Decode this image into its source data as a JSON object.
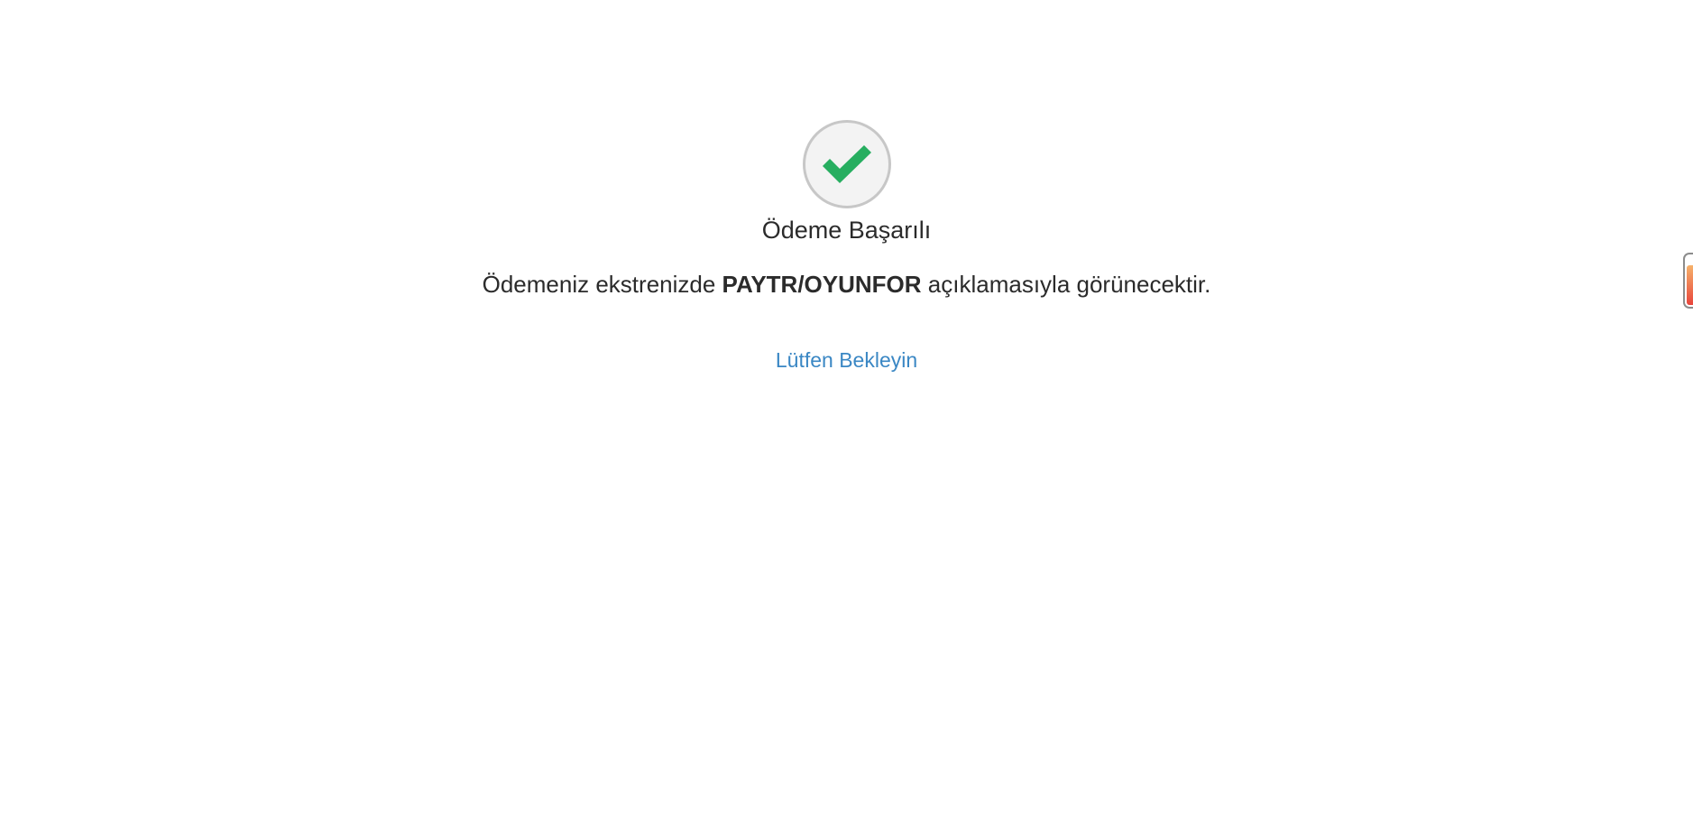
{
  "status": {
    "icon": "checkmark-icon",
    "icon_color": "#27ae60",
    "title": "Ödeme Başarılı"
  },
  "message": {
    "prefix": "Ödemeniz ekstrenizde ",
    "descriptor": "PAYTR/OYUNFOR",
    "suffix": " açıklamasıyla görünecektir."
  },
  "wait_link": {
    "label": "Lütfen Bekleyin",
    "color": "#3a87c4"
  },
  "edge_widget": {
    "icon": "side-tab-icon",
    "fill_colors": [
      "#f6b26b",
      "#e8453c"
    ]
  }
}
